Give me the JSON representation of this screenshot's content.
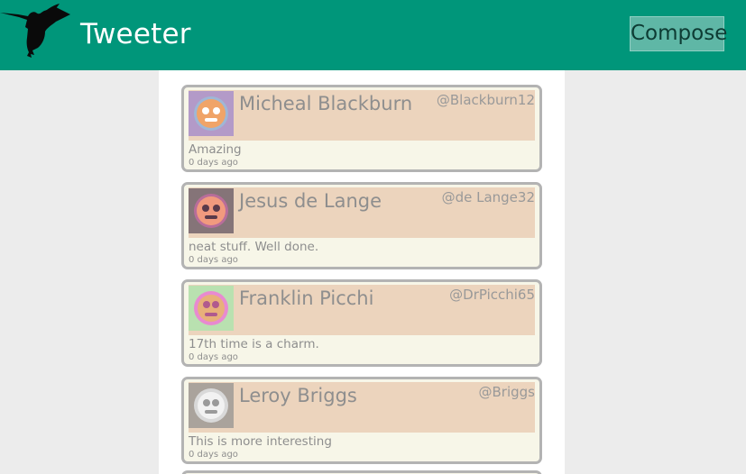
{
  "header": {
    "app_title": "Tweeter",
    "compose_label": "Compose",
    "logo_icon": "hummingbird-icon"
  },
  "colors": {
    "header_bg": "#00967a",
    "compose_bg": "#5fb7a6",
    "card_header_bg": "#ecd4bd",
    "card_body_bg": "#f7f6e8",
    "card_border": "#b3b3b3"
  },
  "tweets": [
    {
      "name": "Micheal Blackburn",
      "handle": "@Blackburn12",
      "text": "Amazing",
      "time": "0 days ago",
      "avatar_icon": "robohash-avatar-icon",
      "avatar_bg": "#b39ac8",
      "avatar_fg": "#f0a468"
    },
    {
      "name": "Jesus de Lange",
      "handle": "@de Lange32",
      "text": "neat stuff. Well done.",
      "time": "0 days ago",
      "avatar_icon": "robohash-avatar-icon",
      "avatar_bg": "#857478",
      "avatar_fg": "#f19a7e"
    },
    {
      "name": "Franklin Picchi",
      "handle": "@DrPicchi65",
      "text": "17th time is a charm.",
      "time": "0 days ago",
      "avatar_icon": "robohash-avatar-icon",
      "avatar_bg": "#b9e1b0",
      "avatar_fg": "#e88ad0"
    },
    {
      "name": "Leroy Briggs",
      "handle": "@Briggs",
      "text": "This is more interesting",
      "time": "0 days ago",
      "avatar_icon": "robohash-avatar-icon",
      "avatar_bg": "#aaa39c",
      "avatar_fg": "#e6e6e6"
    }
  ]
}
